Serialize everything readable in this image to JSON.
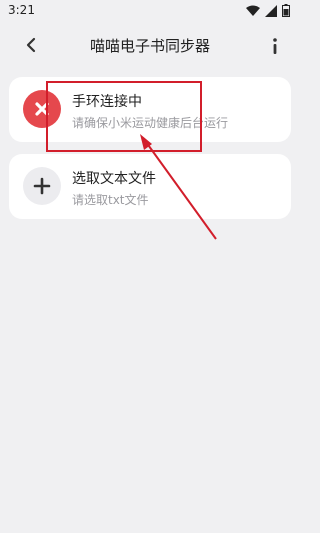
{
  "status_bar": {
    "time": "3:21",
    "icons": [
      "wifi-icon",
      "signal-icon",
      "battery-icon"
    ]
  },
  "app_bar": {
    "back_icon": "back-arrow-icon",
    "title": "喵喵电子书同步器",
    "info_icon": "info-icon"
  },
  "cards": [
    {
      "icon": "close-icon",
      "icon_bg": "#e5484d",
      "title": "手环连接中",
      "subtitle": "请确保小米运动健康后台运行"
    },
    {
      "icon": "plus-icon",
      "icon_bg": "#ececef",
      "title": "选取文本文件",
      "subtitle": "请选取txt文件"
    }
  ],
  "annotation": {
    "color": "#d21e2b"
  }
}
